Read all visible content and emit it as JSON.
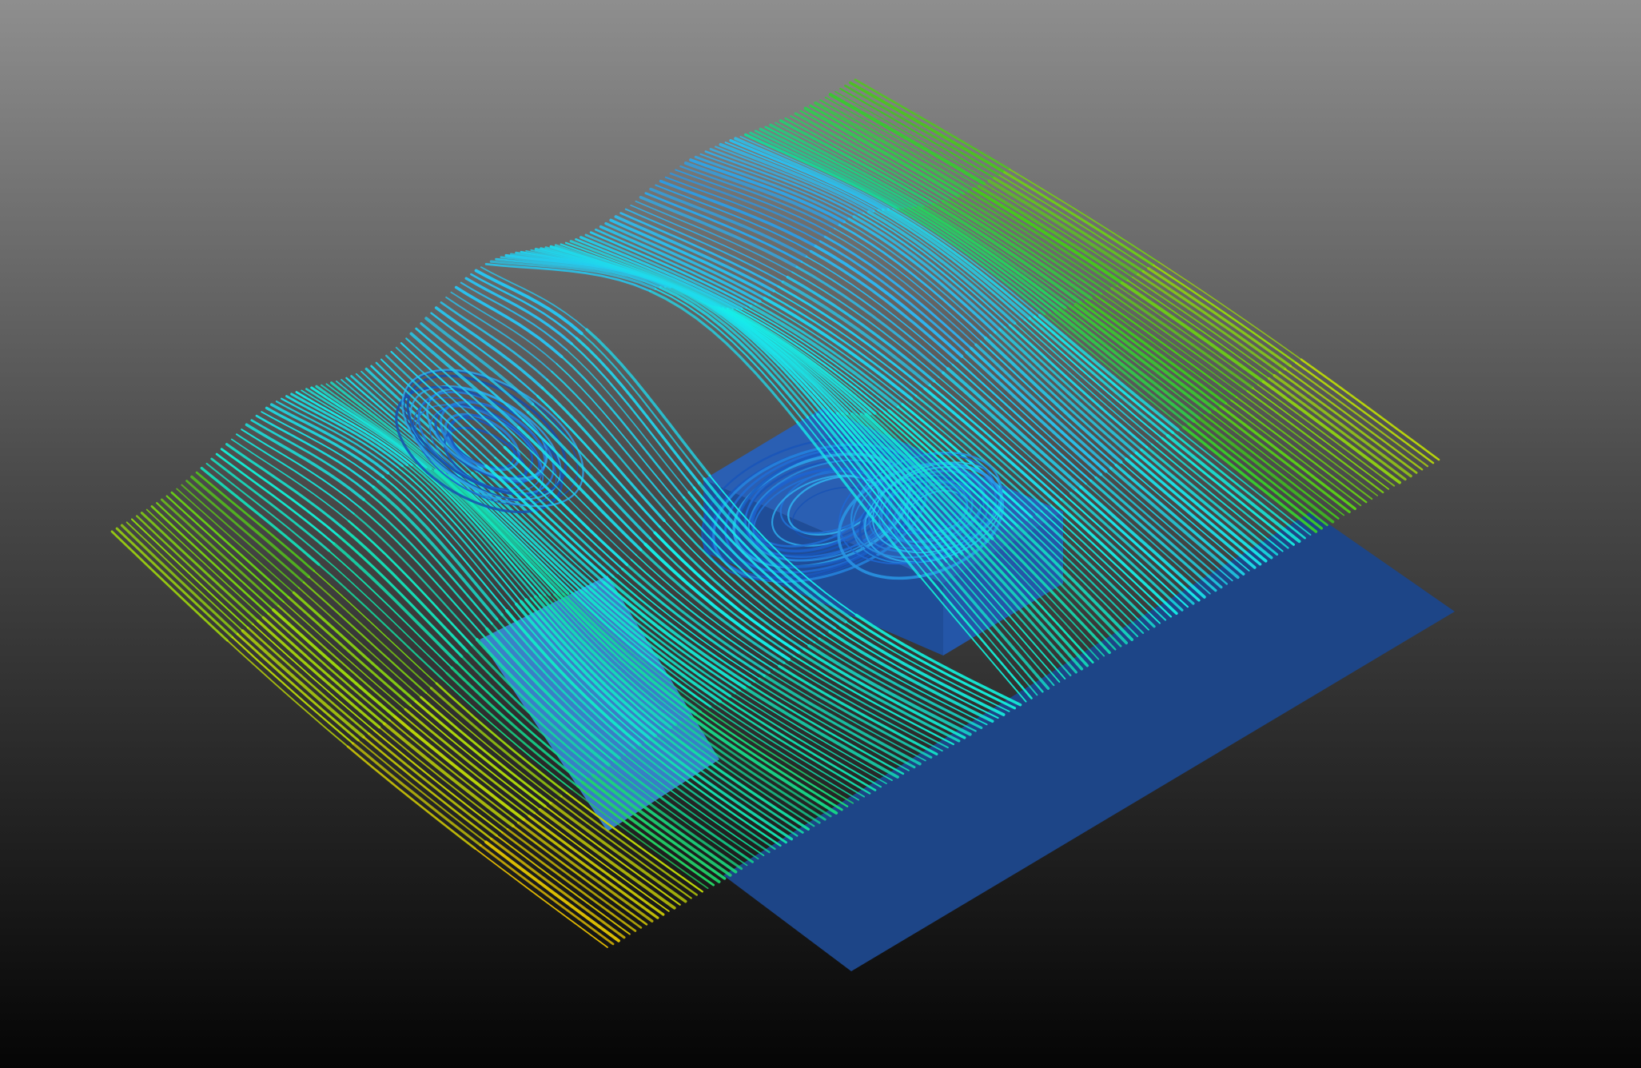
{
  "scene": {
    "background_top": "#8e8e8e",
    "background_bottom": "#050505",
    "ground_plate_color": "#1d4587",
    "obstacle_color": "#2a5fb3",
    "colormap": [
      "#0a2a6e",
      "#1e64d2",
      "#2fb4f0",
      "#15f0ea",
      "#12d890",
      "#3ec81c",
      "#b8dc0a",
      "#f0b000"
    ],
    "icons": [
      "ground-plate",
      "obstacle-block",
      "streamline-tubes"
    ]
  }
}
